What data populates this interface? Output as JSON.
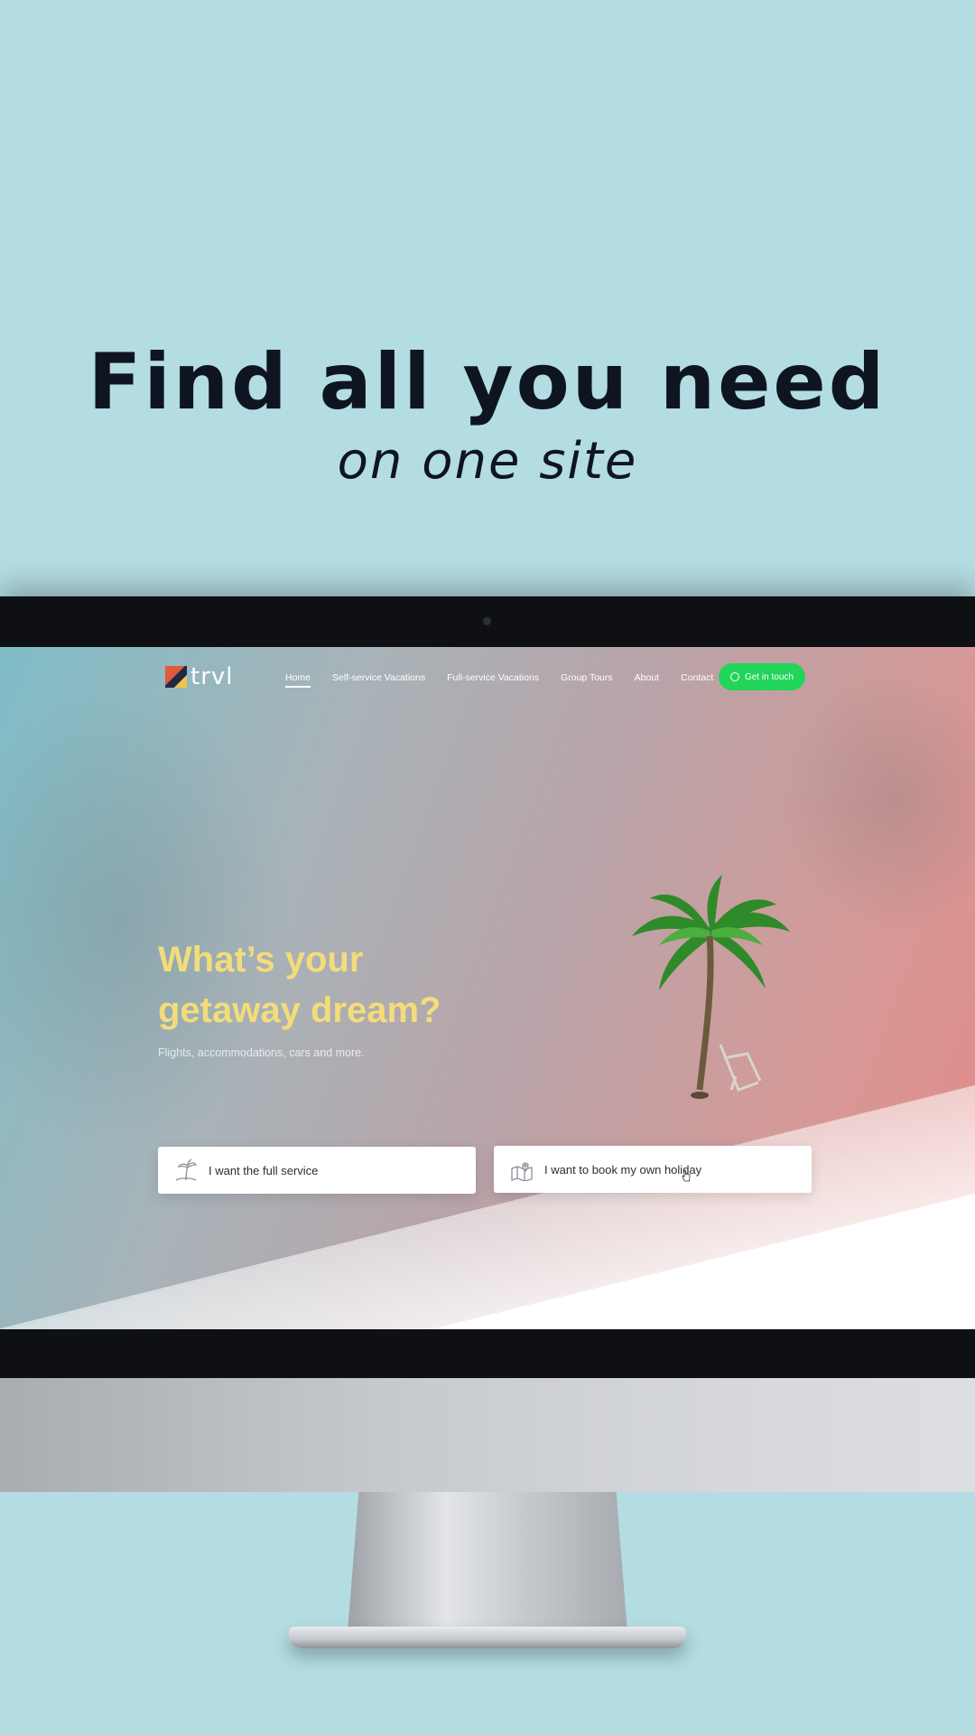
{
  "headline": {
    "line1": "Find all you need",
    "line2": "on one site"
  },
  "website": {
    "logo_text": "trvl",
    "nav": [
      {
        "label": "Home",
        "active": true
      },
      {
        "label": "Self-service Vacations",
        "active": false
      },
      {
        "label": "Full-service Vacations",
        "active": false
      },
      {
        "label": "Group Tours",
        "active": false
      },
      {
        "label": "About",
        "active": false
      },
      {
        "label": "Contact",
        "active": false
      }
    ],
    "cta_label": "Get in touch",
    "hero_title_line1": "What’s your",
    "hero_title_line2": "getaway dream?",
    "hero_subtitle": "Flights, accommodations, cars and more.",
    "choice_full": "I want the full service",
    "choice_own": "I want to book my own holiday"
  },
  "colors": {
    "background": "#b3dde2",
    "cta_green": "#22d45a",
    "hero_title": "#f4dc7a",
    "bezel": "#0e1013"
  }
}
